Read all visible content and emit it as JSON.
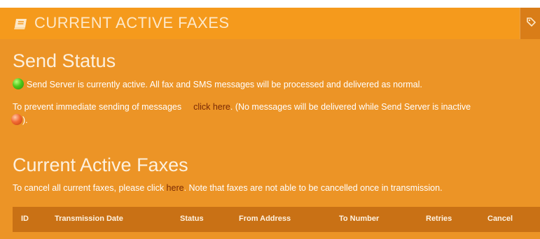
{
  "header": {
    "title": "CURRENT ACTIVE FAXES",
    "icon": "book-icon",
    "tool_icon": "tag-icon"
  },
  "send_status": {
    "heading": "Send Status",
    "status_text": "Send Server is currently active. All fax  and SMS messages will be processed and delivered as normal.",
    "prevent_prefix": "To prevent immediate sending of messages",
    "click_here": "click here",
    "prevent_suffix": ". (No messages will be delivered while Send Server is inactive",
    "prevent_tail": ")."
  },
  "active_faxes": {
    "heading": "Current Active Faxes",
    "cancel_prefix": "To cancel all current faxes, please click ",
    "cancel_link": "here",
    "cancel_suffix": ". Note that faxes are not able to be cancelled once in transmission.",
    "columns": [
      "ID",
      "Transmission Date",
      "Status",
      "From Address",
      "To Number",
      "Retries",
      "Cancel"
    ]
  },
  "colors": {
    "panel": "#ec9426",
    "header": "#f59a1c",
    "table_header": "#c97115",
    "link": "#7a2a05"
  }
}
